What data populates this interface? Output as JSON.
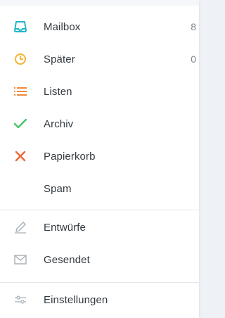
{
  "menu": {
    "mailbox": {
      "label": "Mailbox",
      "count": "8",
      "icon": "inbox-tray-icon",
      "color": "#1fb6c8"
    },
    "spaeter": {
      "label": "Später",
      "count": "0",
      "icon": "clock-icon",
      "color": "#f5b531"
    },
    "listen": {
      "label": "Listen",
      "icon": "list-icon",
      "color": "#f08a3c"
    },
    "archiv": {
      "label": "Archiv",
      "icon": "checkmark-icon",
      "color": "#46c46d"
    },
    "papierkorb": {
      "label": "Papierkorb",
      "icon": "x-icon",
      "color": "#ef6a36"
    },
    "spam": {
      "label": "Spam"
    },
    "entwuerfe": {
      "label": "Entwürfe",
      "icon": "pencil-icon",
      "color": "#a7aeb5"
    },
    "gesendet": {
      "label": "Gesendet",
      "icon": "envelope-icon",
      "color": "#a7aeb5"
    },
    "einstellungen": {
      "label": "Einstellungen",
      "icon": "sliders-icon",
      "color": "#a7aeb5"
    }
  }
}
